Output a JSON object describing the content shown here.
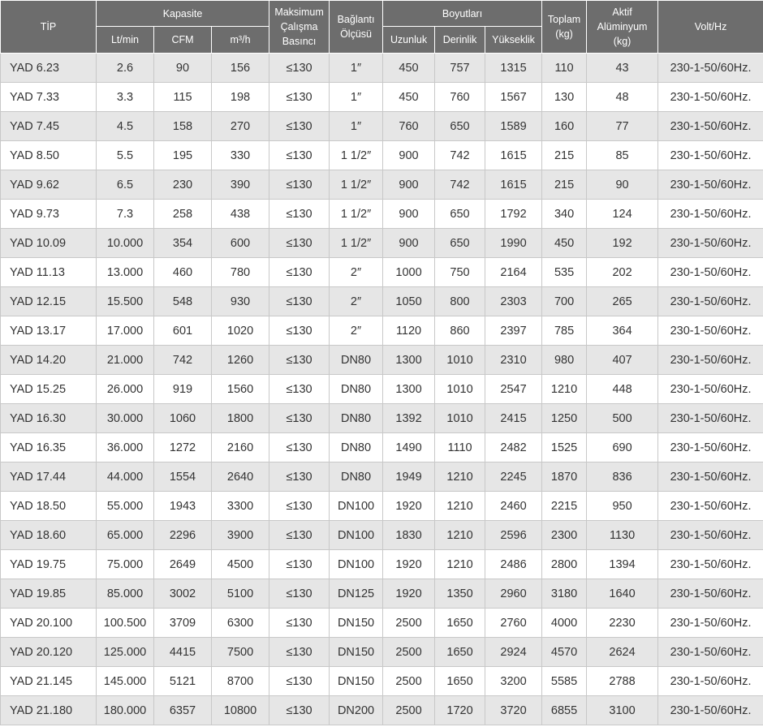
{
  "headers": {
    "tip": "TİP",
    "kapasite": "Kapasite",
    "lt_min": "Lt/min",
    "cfm": "CFM",
    "m3h": "m³/h",
    "max_basinc": [
      "Maksimum",
      "Çalışma",
      "Basıncı"
    ],
    "baglanti": [
      "Bağlantı",
      "Ölçüsü"
    ],
    "boyutlar": "Boyutları",
    "uzunluk": "Uzunluk",
    "derinlik": "Derinlik",
    "yukseklik": "Yükseklik",
    "toplam": [
      "Toplam",
      "(kg)"
    ],
    "aktif": [
      "Aktif",
      "Alüminyum",
      "(kg)"
    ],
    "volt": "Volt/Hz"
  },
  "rows": [
    [
      "YAD 6.23",
      "2.6",
      "90",
      "156",
      "≤130",
      "1″",
      "450",
      "757",
      "1315",
      "110",
      "43",
      "230-1-50/60Hz."
    ],
    [
      "YAD 7.33",
      "3.3",
      "115",
      "198",
      "≤130",
      "1″",
      "450",
      "760",
      "1567",
      "130",
      "48",
      "230-1-50/60Hz."
    ],
    [
      "YAD 7.45",
      "4.5",
      "158",
      "270",
      "≤130",
      "1″",
      "760",
      "650",
      "1589",
      "160",
      "77",
      "230-1-50/60Hz."
    ],
    [
      "YAD 8.50",
      "5.5",
      "195",
      "330",
      "≤130",
      "1 1/2″",
      "900",
      "742",
      "1615",
      "215",
      "85",
      "230-1-50/60Hz."
    ],
    [
      "YAD 9.62",
      "6.5",
      "230",
      "390",
      "≤130",
      "1 1/2″",
      "900",
      "742",
      "1615",
      "215",
      "90",
      "230-1-50/60Hz."
    ],
    [
      "YAD 9.73",
      "7.3",
      "258",
      "438",
      "≤130",
      "1 1/2″",
      "900",
      "650",
      "1792",
      "340",
      "124",
      "230-1-50/60Hz."
    ],
    [
      "YAD 10.09",
      "10.000",
      "354",
      "600",
      "≤130",
      "1 1/2″",
      "900",
      "650",
      "1990",
      "450",
      "192",
      "230-1-50/60Hz."
    ],
    [
      "YAD 11.13",
      "13.000",
      "460",
      "780",
      "≤130",
      "2″",
      "1000",
      "750",
      "2164",
      "535",
      "202",
      "230-1-50/60Hz."
    ],
    [
      "YAD 12.15",
      "15.500",
      "548",
      "930",
      "≤130",
      "2″",
      "1050",
      "800",
      "2303",
      "700",
      "265",
      "230-1-50/60Hz."
    ],
    [
      "YAD 13.17",
      "17.000",
      "601",
      "1020",
      "≤130",
      "2″",
      "1120",
      "860",
      "2397",
      "785",
      "364",
      "230-1-50/60Hz."
    ],
    [
      "YAD 14.20",
      "21.000",
      "742",
      "1260",
      "≤130",
      "DN80",
      "1300",
      "1010",
      "2310",
      "980",
      "407",
      "230-1-50/60Hz."
    ],
    [
      "YAD 15.25",
      "26.000",
      "919",
      "1560",
      "≤130",
      "DN80",
      "1300",
      "1010",
      "2547",
      "1210",
      "448",
      "230-1-50/60Hz."
    ],
    [
      "YAD 16.30",
      "30.000",
      "1060",
      "1800",
      "≤130",
      "DN80",
      "1392",
      "1010",
      "2415",
      "1250",
      "500",
      "230-1-50/60Hz."
    ],
    [
      "YAD 16.35",
      "36.000",
      "1272",
      "2160",
      "≤130",
      "DN80",
      "1490",
      "1110",
      "2482",
      "1525",
      "690",
      "230-1-50/60Hz."
    ],
    [
      "YAD 17.44",
      "44.000",
      "1554",
      "2640",
      "≤130",
      "DN80",
      "1949",
      "1210",
      "2245",
      "1870",
      "836",
      "230-1-50/60Hz."
    ],
    [
      "YAD 18.50",
      "55.000",
      "1943",
      "3300",
      "≤130",
      "DN100",
      "1920",
      "1210",
      "2460",
      "2215",
      "950",
      "230-1-50/60Hz."
    ],
    [
      "YAD 18.60",
      "65.000",
      "2296",
      "3900",
      "≤130",
      "DN100",
      "1830",
      "1210",
      "2596",
      "2300",
      "1130",
      "230-1-50/60Hz."
    ],
    [
      "YAD 19.75",
      "75.000",
      "2649",
      "4500",
      "≤130",
      "DN100",
      "1920",
      "1210",
      "2486",
      "2800",
      "1394",
      "230-1-50/60Hz."
    ],
    [
      "YAD 19.85",
      "85.000",
      "3002",
      "5100",
      "≤130",
      "DN125",
      "1920",
      "1350",
      "2960",
      "3180",
      "1640",
      "230-1-50/60Hz."
    ],
    [
      "YAD 20.100",
      "100.500",
      "3709",
      "6300",
      "≤130",
      "DN150",
      "2500",
      "1650",
      "2760",
      "4000",
      "2230",
      "230-1-50/60Hz."
    ],
    [
      "YAD 20.120",
      "125.000",
      "4415",
      "7500",
      "≤130",
      "DN150",
      "2500",
      "1650",
      "2924",
      "4570",
      "2624",
      "230-1-50/60Hz."
    ],
    [
      "YAD 21.145",
      "145.000",
      "5121",
      "8700",
      "≤130",
      "DN150",
      "2500",
      "1650",
      "3200",
      "5585",
      "2788",
      "230-1-50/60Hz."
    ],
    [
      "YAD 21.180",
      "180.000",
      "6357",
      "10800",
      "≤130",
      "DN200",
      "2500",
      "1720",
      "3720",
      "6855",
      "3100",
      "230-1-50/60Hz."
    ]
  ]
}
